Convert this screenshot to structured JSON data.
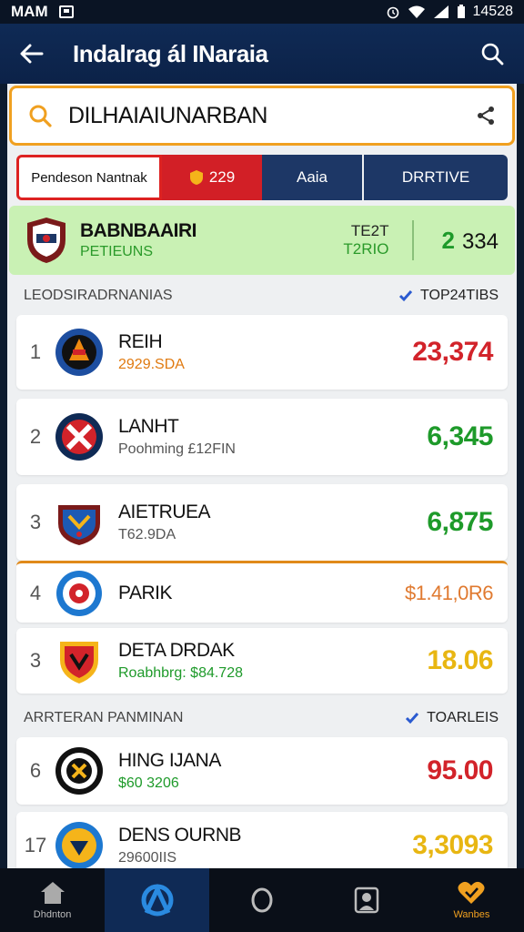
{
  "status_bar": {
    "left_text": "MAM",
    "time": "14528"
  },
  "app_bar": {
    "title": "Indalrag ál INaraia"
  },
  "search": {
    "value": "DILHAIAIUNARBAN"
  },
  "tabs": [
    {
      "label": "Pendeson Nantnak"
    },
    {
      "label": "229"
    },
    {
      "label": "Aaia"
    },
    {
      "label": "DRRTIVE"
    }
  ],
  "featured": {
    "name": "BABNBAAIRI",
    "sub": "PETIEUNS",
    "mid_top": "TE2T",
    "mid_bottom": "T2RIO",
    "value_green": "2",
    "value_dark": "334"
  },
  "section1": {
    "title": "LEODSIRADRNANIAS",
    "right": "TOP24TIBS"
  },
  "section2": {
    "title": "ARRTERAN PANMINAN",
    "right": "TOARLEIS"
  },
  "rows": [
    {
      "rank": "1",
      "name": "REIH",
      "sub": "2929.SDA",
      "value": "23,374",
      "value_color": "#d2232a",
      "sub_color": "#e07a10"
    },
    {
      "rank": "2",
      "name": "LANHT",
      "sub": "Poohming  £12FIN",
      "value": "6,345",
      "value_color": "#1e9a2a",
      "sub_color": "#555555"
    },
    {
      "rank": "3",
      "name": "AIETRUEA",
      "sub": "T62.9DA",
      "value": "6,875",
      "value_color": "#1e9a2a",
      "sub_color": "#555555"
    },
    {
      "rank": "4",
      "name": "PARIK",
      "sub": "",
      "value": "$1.41,0R6",
      "value_color": "#e07a30",
      "sub_color": "#555555"
    },
    {
      "rank": "3",
      "name": "DETA DRDAK",
      "sub": "Roabhbrg: $84.728",
      "value": "18.06",
      "value_color": "#e8b612",
      "sub_color": "#1e9a2a"
    },
    {
      "rank": "6",
      "name": "HING IJANA",
      "sub": "$60 3206",
      "value": "95.00",
      "value_color": "#d2232a",
      "sub_color": "#1e9a2a"
    },
    {
      "rank": "17",
      "name": "DENS OURNB",
      "sub": "29600IIS",
      "value": "3,3093",
      "value_color": "#e8b612",
      "sub_color": "#555555"
    }
  ],
  "bottom_nav": [
    {
      "label": "Dhdnton",
      "icon": "home-icon"
    },
    {
      "label": "",
      "icon": "ring-logo-icon"
    },
    {
      "label": "",
      "icon": "circle-icon"
    },
    {
      "label": "",
      "icon": "profile-icon"
    },
    {
      "label": "Wanbes",
      "icon": "heart-icon"
    }
  ]
}
